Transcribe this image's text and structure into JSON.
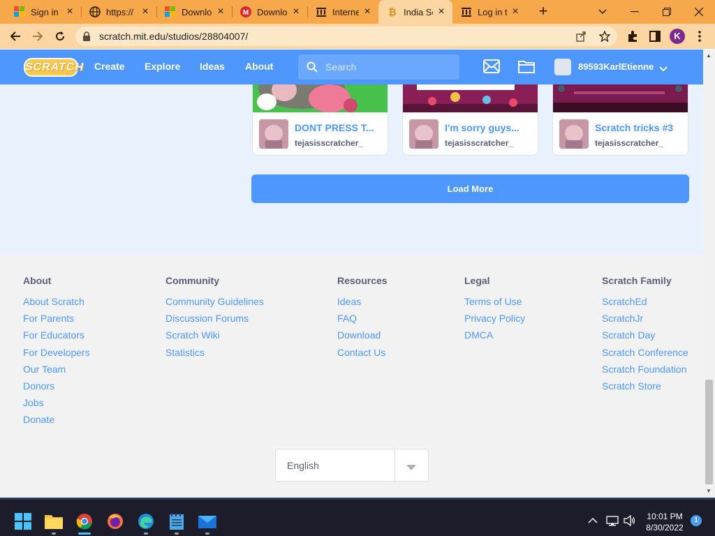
{
  "browser": {
    "tabs": [
      {
        "label": "Sign in to",
        "icon": "microsoft-icon"
      },
      {
        "label": "https://",
        "icon": "globe-icon"
      },
      {
        "label": "Downlo",
        "icon": "microsoft-icon"
      },
      {
        "label": "Downlo",
        "icon": "mega-icon"
      },
      {
        "label": "Internet",
        "icon": "archive-icon"
      },
      {
        "label": "India Sc",
        "icon": "bitcoin-icon",
        "active": true
      },
      {
        "label": "Log in t",
        "icon": "archive-icon"
      }
    ],
    "url": "scratch.mit.edu/studios/28804007/",
    "profile_initial": "K"
  },
  "scratch_nav": {
    "logo": "SCRATCH",
    "links": [
      "Create",
      "Explore",
      "Ideas",
      "About"
    ],
    "search_placeholder": "Search",
    "username": "89593KarlEtienne"
  },
  "projects": [
    {
      "title": "DONT PRESS T...",
      "author": "tejasisscratcher_"
    },
    {
      "title": "I'm sorry guys...",
      "author": "tejasisscratcher_"
    },
    {
      "title": "Scratch tricks #3",
      "author": "tejasisscratcher_"
    }
  ],
  "load_more": "Load More",
  "footer": {
    "columns": [
      {
        "heading": "About",
        "links": [
          "About Scratch",
          "For Parents",
          "For Educators",
          "For Developers",
          "Our Team",
          "Donors",
          "Jobs",
          "Donate"
        ]
      },
      {
        "heading": "Community",
        "links": [
          "Community Guidelines",
          "Discussion Forums",
          "Scratch Wiki",
          "Statistics"
        ]
      },
      {
        "heading": "Resources",
        "links": [
          "Ideas",
          "FAQ",
          "Download",
          "Contact Us"
        ]
      },
      {
        "heading": "Legal",
        "links": [
          "Terms of Use",
          "Privacy Policy",
          "DMCA"
        ]
      },
      {
        "heading": "Scratch Family",
        "links": [
          "ScratchEd",
          "ScratchJr",
          "Scratch Day",
          "Scratch Conference",
          "Scratch Foundation",
          "Scratch Store"
        ]
      }
    ],
    "language": "English"
  },
  "taskbar": {
    "time": "10:01 PM",
    "date": "8/30/2022",
    "notification_count": "1"
  },
  "colors": {
    "tab_strip": "#f7a84a",
    "scratch_blue": "#4d97ff",
    "footer_bg": "#f2f2f2",
    "page_bg": "#e9f1fc"
  }
}
